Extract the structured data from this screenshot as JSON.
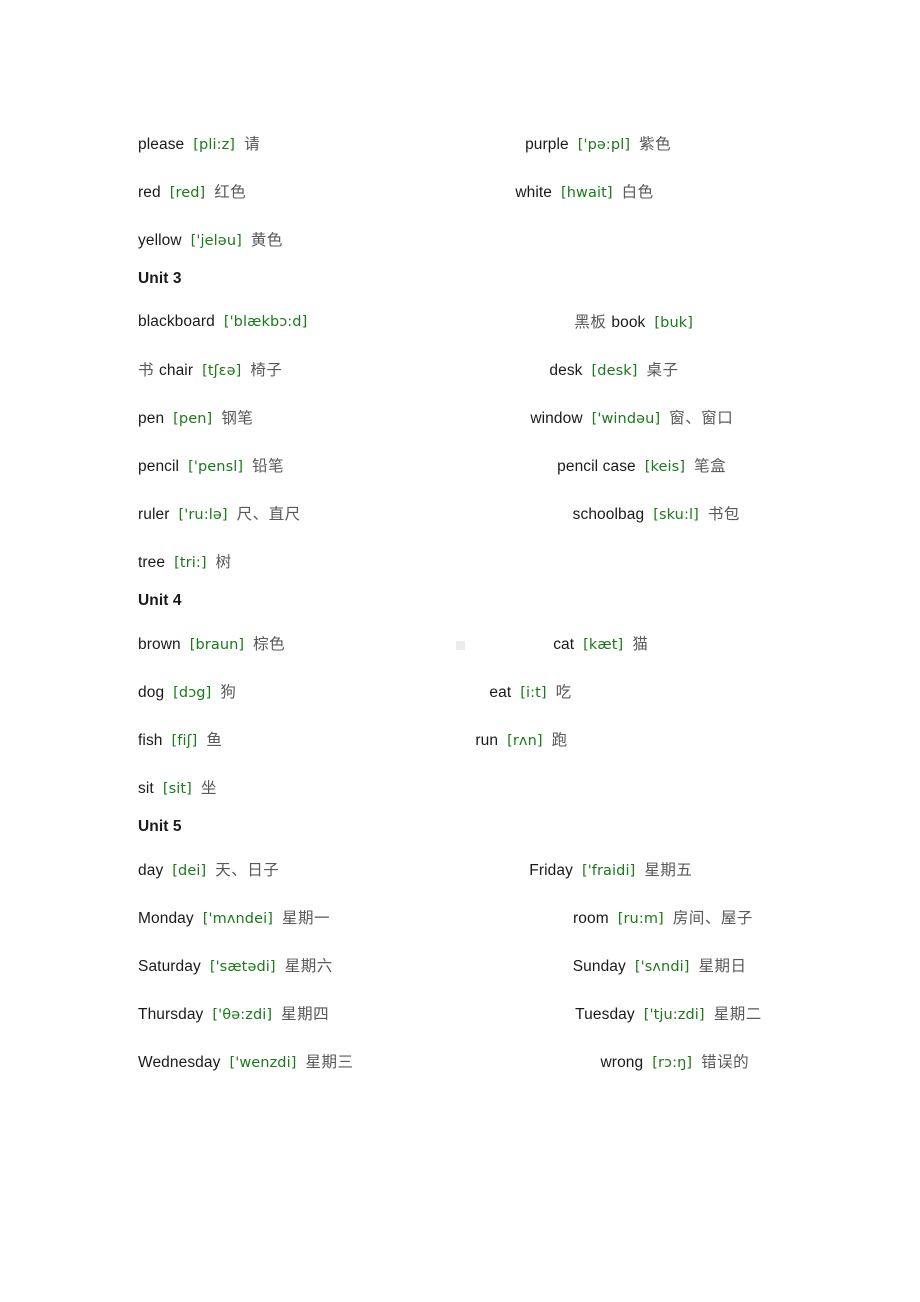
{
  "document": {
    "type": "vocabulary-word-list",
    "language_pair": "English-Chinese",
    "colors": {
      "english": "#1a1a1a",
      "phonetic": "#1a7a1a",
      "chinese": "#585858",
      "background": "#ffffff",
      "artifact": "#ececec"
    }
  },
  "blocks": [
    {
      "kind": "rows",
      "rows": [
        {
          "left": {
            "word": "please",
            "ipa": "[pli:z]",
            "zh": "请"
          },
          "right": {
            "word": "purple",
            "ipa": "['pə:pl]",
            "zh": "紫色"
          }
        },
        {
          "left": {
            "word": "red",
            "ipa": "[red]",
            "zh": "红色"
          },
          "right": {
            "word": "white",
            "ipa": "[hwait]",
            "zh": "白色"
          }
        },
        {
          "left": {
            "word": "yellow",
            "ipa": "['jeləu]",
            "zh": "黄色"
          },
          "right": null
        }
      ]
    },
    {
      "kind": "heading",
      "heading": "Unit 3"
    },
    {
      "kind": "rows",
      "rows": [
        {
          "left": {
            "word": "blackboard",
            "ipa": "['blækbɔ:d]",
            "zh": ""
          },
          "right": {
            "zh_lead": "黑板",
            "word": "book",
            "ipa": "[buk]",
            "zh": ""
          }
        },
        {
          "left": {
            "zh_lead": "书",
            "word": "chair",
            "ipa": "[tʃɛə]",
            "zh": "椅子"
          },
          "right": {
            "word": "desk",
            "ipa": "[desk]",
            "zh": "桌子"
          }
        },
        {
          "left": {
            "word": "pen",
            "ipa": "[pen]",
            "zh": "钢笔"
          },
          "right": {
            "word": "window",
            "ipa": "['windəu]",
            "zh": "窗、窗口"
          }
        },
        {
          "left": {
            "word": "pencil",
            "ipa": "['pensl]",
            "zh": "铅笔"
          },
          "right": {
            "word": "pencil case",
            "ipa": "[keis]",
            "zh": "笔盒"
          }
        },
        {
          "left": {
            "word": "ruler",
            "ipa": "['ru:lə]",
            "zh": "尺、直尺"
          },
          "right": {
            "word": "schoolbag",
            "ipa": "[sku:l]",
            "zh": "书包"
          }
        },
        {
          "left": {
            "word": "tree",
            "ipa": "[tri:]",
            "zh": "树"
          },
          "right": null
        }
      ]
    },
    {
      "kind": "heading",
      "heading": "Unit 4"
    },
    {
      "kind": "rows",
      "rows": [
        {
          "left": {
            "word": "brown",
            "ipa": "[braun]",
            "zh": "棕色"
          },
          "right": {
            "word": "cat",
            "ipa": "[kæt]",
            "zh": "猫"
          }
        },
        {
          "left": {
            "word": "dog",
            "ipa": "[dɔg]",
            "zh": "狗"
          },
          "right": {
            "word": "eat",
            "ipa": "[i:t]",
            "zh": "吃"
          }
        },
        {
          "left": {
            "word": "fish",
            "ipa": "[fiʃ]",
            "zh": "鱼"
          },
          "right": {
            "word": "run",
            "ipa": "[rʌn]",
            "zh": "跑"
          }
        },
        {
          "left": {
            "word": "sit",
            "ipa": "[sit]",
            "zh": "坐"
          },
          "right": null
        }
      ]
    },
    {
      "kind": "heading",
      "heading": "Unit 5"
    },
    {
      "kind": "rows",
      "rows": [
        {
          "left": {
            "word": "day",
            "ipa": "[dei]",
            "zh": "天、日子"
          },
          "right": {
            "word": "Friday",
            "ipa": "['fraidi]",
            "zh": "星期五"
          }
        },
        {
          "left": {
            "word": "Monday",
            "ipa": "['mʌndei]",
            "zh": "星期一"
          },
          "right": {
            "word": "room",
            "ipa": "[ru:m]",
            "zh": "房间、屋子"
          }
        },
        {
          "left": {
            "word": "Saturday",
            "ipa": "['sætədi]",
            "zh": "星期六"
          },
          "right": {
            "word": "Sunday",
            "ipa": "['sʌndi]",
            "zh": "星期日"
          }
        },
        {
          "left": {
            "word": "Thursday",
            "ipa": "['θə:zdi]",
            "zh": "星期四"
          },
          "right": {
            "word": "Tuesday",
            "ipa": "['tju:zdi]",
            "zh": "星期二"
          }
        },
        {
          "left": {
            "word": "Wednesday",
            "ipa": "['wenzdi]",
            "zh": "星期三"
          },
          "right": {
            "word": "wrong",
            "ipa": "[rɔ:ŋ]",
            "zh": "错误的"
          }
        }
      ]
    }
  ]
}
